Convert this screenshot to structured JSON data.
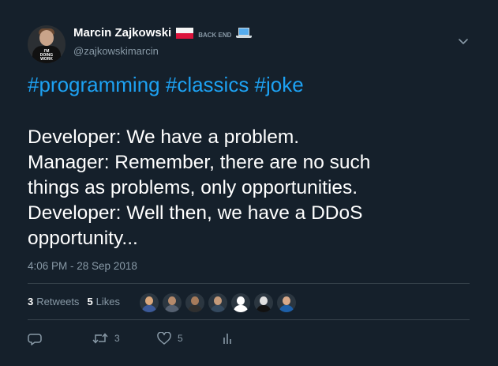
{
  "author": {
    "display_name": "Marcin Zajkowski",
    "handle": "@zajkowskimarcin",
    "badge_text": "BACK END",
    "avatar_shirt_text": "I'M DOING WORK"
  },
  "tweet": {
    "hashtags": "#programming #classics #joke",
    "lines": [
      "Developer: We have a problem.",
      "Manager: Remember, there are no such",
      "things as problems, only opportunities.",
      "Developer: Well then, we have a DDoS",
      "opportunity..."
    ],
    "timestamp": "4:06 PM - 28 Sep 2018"
  },
  "stats": {
    "retweets_count": "3",
    "retweets_label": "Retweets",
    "likes_count": "5",
    "likes_label": "Likes"
  },
  "actions": {
    "retweet_count": "3",
    "like_count": "5"
  },
  "likers": [
    {
      "name": "liker-1",
      "face": "#d9a77c",
      "body": "#3b5998"
    },
    {
      "name": "liker-2",
      "face": "#b58a6b",
      "body": "#556070"
    },
    {
      "name": "liker-3",
      "face": "#a67b5b",
      "body": "#2f2f2f"
    },
    {
      "name": "liker-4",
      "face": "#c49a7a",
      "body": "#34495e"
    },
    {
      "name": "liker-5",
      "face": "#ffffff",
      "body": "#ffffff"
    },
    {
      "name": "liker-6",
      "face": "#e0e0e0",
      "body": "#111111"
    },
    {
      "name": "liker-7",
      "face": "#d7a98a",
      "body": "#1d5fa8"
    }
  ],
  "colors": {
    "background": "#15202b",
    "accent": "#1da1f2",
    "secondary_text": "#8899a6",
    "divider": "#38444d"
  }
}
